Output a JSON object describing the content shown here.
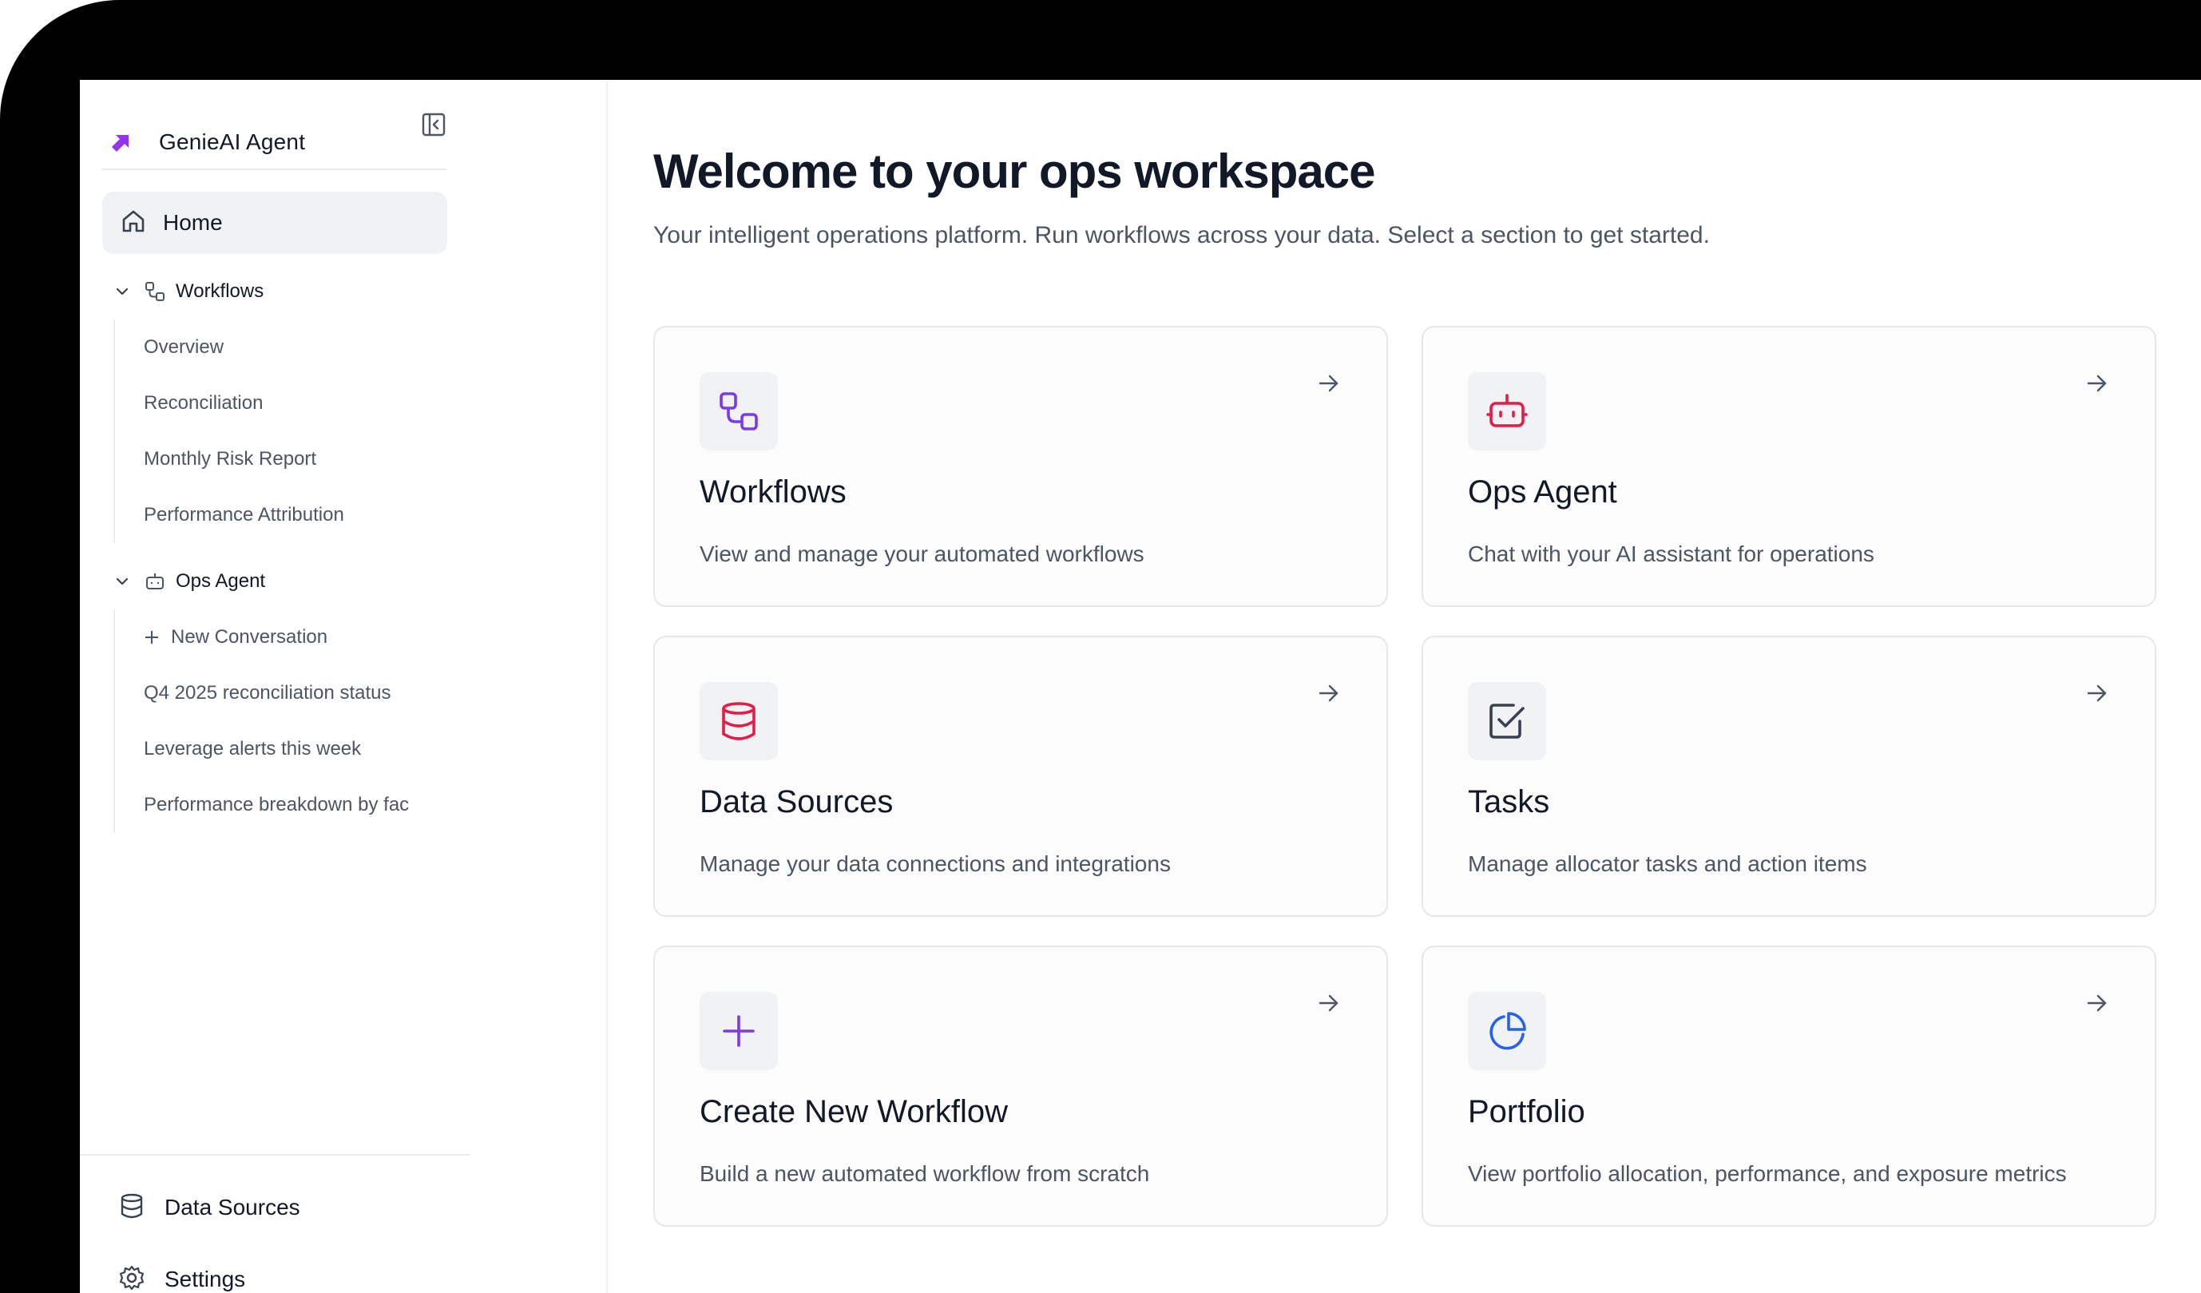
{
  "sidebar": {
    "brand_name": "GenieAI Agent",
    "home_label": "Home",
    "workflows": {
      "label": "Workflows",
      "items": [
        "Overview",
        "Reconciliation",
        "Monthly Risk Report",
        "Performance Attribution"
      ]
    },
    "ops_agent": {
      "label": "Ops Agent",
      "new_conversation": "New Conversation",
      "items": [
        "Q4 2025 reconciliation status",
        "Leverage alerts this week",
        "Performance breakdown by fac"
      ]
    },
    "bottom": {
      "data_sources": "Data Sources",
      "settings": "Settings"
    }
  },
  "main": {
    "title": "Welcome to your ops workspace",
    "subtitle": "Your intelligent operations platform. Run workflows across your data. Select a section to get started.",
    "cards": [
      {
        "title": "Workflows",
        "desc": "View and manage your automated workflows",
        "icon": "workflow-icon",
        "color": "#7c3aed"
      },
      {
        "title": "Ops Agent",
        "desc": "Chat with your AI assistant for operations",
        "icon": "bot-icon",
        "color": "#e11d48"
      },
      {
        "title": "Data Sources",
        "desc": "Manage your data connections and integrations",
        "icon": "database-icon",
        "color": "#e11d48"
      },
      {
        "title": "Tasks",
        "desc": "Manage allocator tasks and action items",
        "icon": "checkbox-icon",
        "color": "#374151"
      },
      {
        "title": "Create New Workflow",
        "desc": "Build a new automated workflow from scratch",
        "icon": "plus-icon",
        "color": "#7c3aed"
      },
      {
        "title": "Portfolio",
        "desc": "View portfolio allocation, performance, and exposure metrics",
        "icon": "pie-chart-icon",
        "color": "#2563eb"
      }
    ]
  },
  "colors": {
    "brand_accent": "#9333ea",
    "text_primary": "#111827",
    "text_secondary": "#4b5563"
  }
}
